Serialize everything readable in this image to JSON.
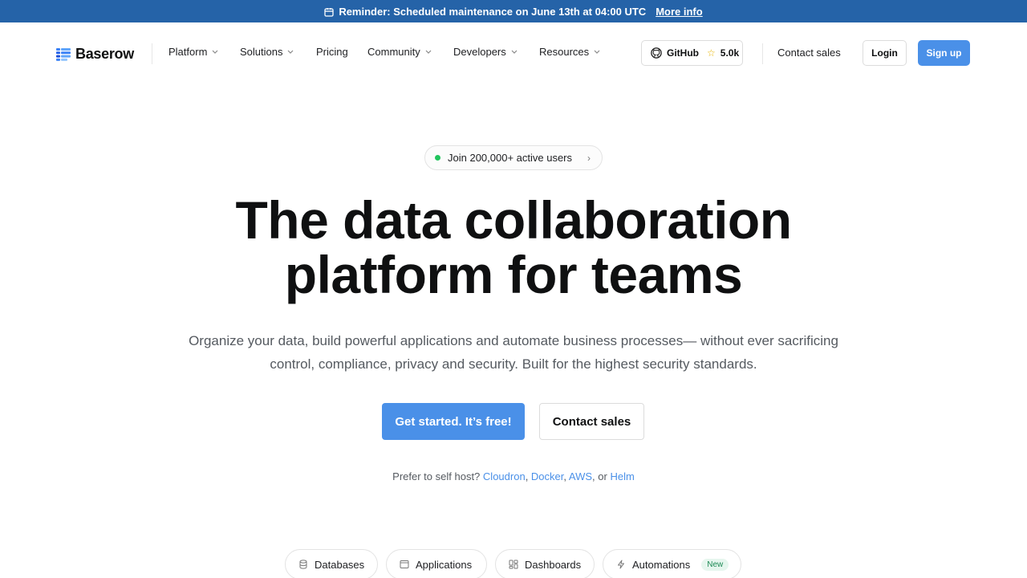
{
  "banner": {
    "icon": "calendar-icon",
    "text": "Reminder: Scheduled maintenance on June 13th at 04:00 UTC",
    "link": "More info"
  },
  "brand": {
    "name": "Baserow",
    "icon": "baserow-logo"
  },
  "nav": {
    "items": [
      {
        "label": "Platform"
      },
      {
        "label": "Solutions"
      },
      {
        "label": "Pricing"
      },
      {
        "label": "Community"
      },
      {
        "label": "Developers"
      },
      {
        "label": "Resources"
      }
    ],
    "github": {
      "label": "GitHub",
      "stars": "5.0k",
      "icon": "github-icon"
    },
    "contact": "Contact sales",
    "login": "Login",
    "signup": "Sign up"
  },
  "hero": {
    "pill": "Join 200,000+ active users",
    "title_line1": "The data collaboration",
    "title_line2": "platform for teams",
    "subtitle_line1": "Organize your data, build powerful applications and automate business processes— without ever sacrificing",
    "subtitle_line2": "control, compliance, privacy and security. Built for the highest security standards.",
    "cta_primary": "Get started. It’s free!",
    "cta_secondary": "Contact sales"
  },
  "selfhost": {
    "prefix": "Prefer to self host?",
    "links": [
      "Cloudron",
      "Docker",
      "AWS",
      "Helm"
    ],
    "or": "or"
  },
  "tabs": [
    {
      "label": "Databases",
      "icon": "database-icon"
    },
    {
      "label": "Applications",
      "icon": "window-icon"
    },
    {
      "label": "Dashboards",
      "icon": "dashboard-icon"
    },
    {
      "label": "Automations",
      "icon": "lightning-icon",
      "badge": "New"
    }
  ],
  "colors": {
    "banner": "#2563a8",
    "accent": "#4a90e8",
    "status_dot": "#22c55e"
  }
}
